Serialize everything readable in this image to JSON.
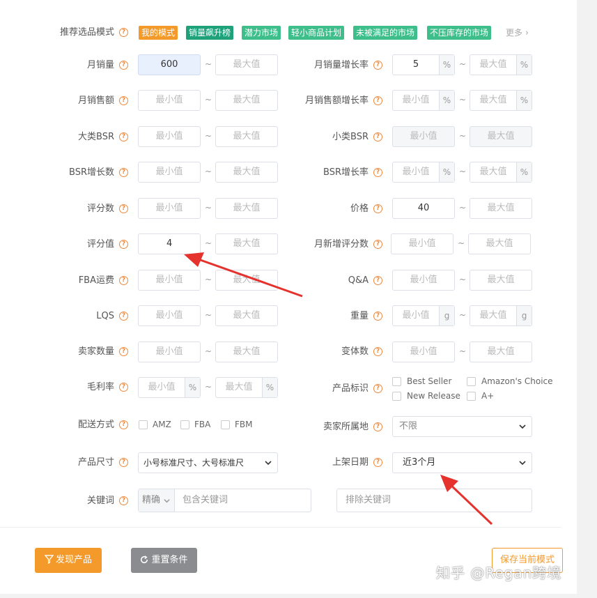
{
  "mode_row": {
    "label": "推荐选品模式",
    "tags": [
      {
        "text": "我的模式",
        "color": "#f39a2b"
      },
      {
        "text": "销量飙升榜",
        "color": "#1fa17a"
      },
      {
        "text": "潜力市场",
        "color": "#3dbe8a"
      },
      {
        "text": "轻小商品计划",
        "color": "#3dbe8a"
      },
      {
        "text": "未被满足的市场",
        "color": "#3dbe8a"
      },
      {
        "text": "不压库存的市场",
        "color": "#3dbe8a"
      }
    ],
    "more": "更多"
  },
  "filters": {
    "monthly_sales": {
      "label": "月销量",
      "min": "600",
      "max": "最大值"
    },
    "monthly_sales_growth": {
      "label": "月销量增长率",
      "min": "5",
      "max": "最大值",
      "unit": "%"
    },
    "monthly_revenue": {
      "label": "月销售额",
      "min": "最小值",
      "max": "最大值"
    },
    "monthly_revenue_growth": {
      "label": "月销售额增长率",
      "min": "最小值",
      "max": "最大值",
      "unit": "%"
    },
    "main_bsr": {
      "label": "大类BSR",
      "min": "最小值",
      "max": "最大值"
    },
    "sub_bsr": {
      "label": "小类BSR",
      "min": "最小值",
      "max": "最大值"
    },
    "bsr_growth_count": {
      "label": "BSR增长数",
      "min": "最小值",
      "max": "最大值"
    },
    "bsr_growth_rate": {
      "label": "BSR增长率",
      "min": "最小值",
      "max": "最大值",
      "unit": "%"
    },
    "review_count": {
      "label": "评分数",
      "min": "最小值",
      "max": "最大值"
    },
    "price": {
      "label": "价格",
      "min": "40",
      "max": "最大值"
    },
    "rating": {
      "label": "评分值",
      "min": "4",
      "max": "最大值"
    },
    "new_reviews": {
      "label": "月新增评分数",
      "min": "最小值",
      "max": "最大值"
    },
    "fba_fee": {
      "label": "FBA运费",
      "min": "最小值",
      "max": "最大值"
    },
    "qa": {
      "label": "Q&A",
      "min": "最小值",
      "max": "最大值"
    },
    "lqs": {
      "label": "LQS",
      "min": "最小值",
      "max": "最大值"
    },
    "weight": {
      "label": "重量",
      "min": "最小值",
      "max": "最大值",
      "unit": "g"
    },
    "seller_count": {
      "label": "卖家数量",
      "min": "最小值",
      "max": "最大值"
    },
    "variant_count": {
      "label": "变体数",
      "min": "最小值",
      "max": "最大值"
    },
    "gross_margin": {
      "label": "毛利率",
      "min": "最小值",
      "max": "最大值",
      "unit": "%"
    }
  },
  "product_badges": {
    "label": "产品标识",
    "options": [
      "Best Seller",
      "Amazon's Choice",
      "New Release",
      "A+"
    ]
  },
  "delivery": {
    "label": "配送方式",
    "options": [
      "AMZ",
      "FBA",
      "FBM"
    ]
  },
  "seller_location": {
    "label": "卖家所属地",
    "value": "不限"
  },
  "product_size": {
    "label": "产品尺寸",
    "value": "小号标准尺寸、大号标准尺"
  },
  "listing_date": {
    "label": "上架日期",
    "value": "近3个月"
  },
  "keywords": {
    "label": "关键词",
    "match": "精确",
    "include_placeholder": "包含关键词",
    "exclude_placeholder": "排除关键词"
  },
  "actions": {
    "discover": "发现产品",
    "reset": "重置条件",
    "save": "保存当前模式"
  },
  "watermark": "知乎 @Regan跨境",
  "colors": {
    "orange": "#f39a2b",
    "gray_button": "#8a8c8f",
    "arrow": "#e5322d",
    "tag_green": "#3dbe8a",
    "tag_dark_green": "#1fa17a"
  }
}
